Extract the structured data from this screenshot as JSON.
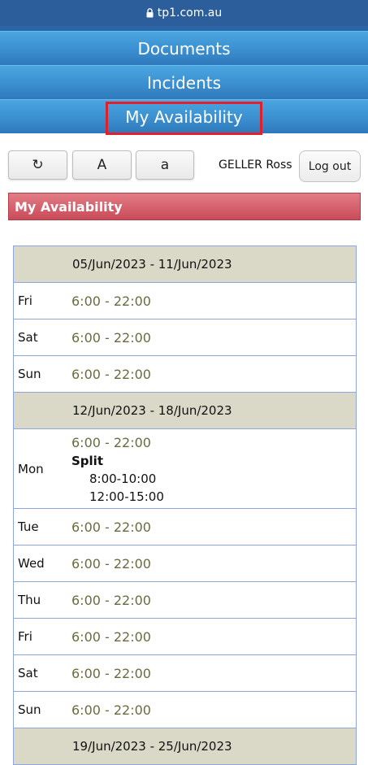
{
  "browser": {
    "url": "tp1.com.au"
  },
  "nav": {
    "items": [
      {
        "label": "Documents"
      },
      {
        "label": "Incidents"
      },
      {
        "label": "My Availability"
      }
    ]
  },
  "toolbar": {
    "refresh_label": "↻",
    "font_large_label": "A",
    "font_small_label": "a",
    "user_name": "GELLER Ross",
    "logout_label": "Log out"
  },
  "section": {
    "title": "My Availability"
  },
  "weeks": [
    {
      "range": "05/Jun/2023 - 11/Jun/2023",
      "days": [
        {
          "day": "Fri",
          "time": "6:00 - 22:00"
        },
        {
          "day": "Sat",
          "time": "6:00 - 22:00"
        },
        {
          "day": "Sun",
          "time": "6:00 - 22:00"
        }
      ]
    },
    {
      "range": "12/Jun/2023 - 18/Jun/2023",
      "days": [
        {
          "day": "Mon",
          "time": "6:00 - 22:00",
          "split_label": "Split",
          "split_slots": [
            "8:00-10:00",
            "12:00-15:00"
          ]
        },
        {
          "day": "Tue",
          "time": "6:00 - 22:00"
        },
        {
          "day": "Wed",
          "time": "6:00 - 22:00"
        },
        {
          "day": "Thu",
          "time": "6:00 - 22:00"
        },
        {
          "day": "Fri",
          "time": "6:00 - 22:00"
        },
        {
          "day": "Sat",
          "time": "6:00 - 22:00"
        },
        {
          "day": "Sun",
          "time": "6:00 - 22:00"
        }
      ]
    },
    {
      "range": "19/Jun/2023 - 25/Jun/2023",
      "days": []
    }
  ],
  "colors": {
    "nav_blue": "#3b8fd0",
    "header_red": "#c94b58",
    "week_bg": "#dad9c8",
    "time_text": "#6b6b3e",
    "highlight": "#e0202a"
  }
}
